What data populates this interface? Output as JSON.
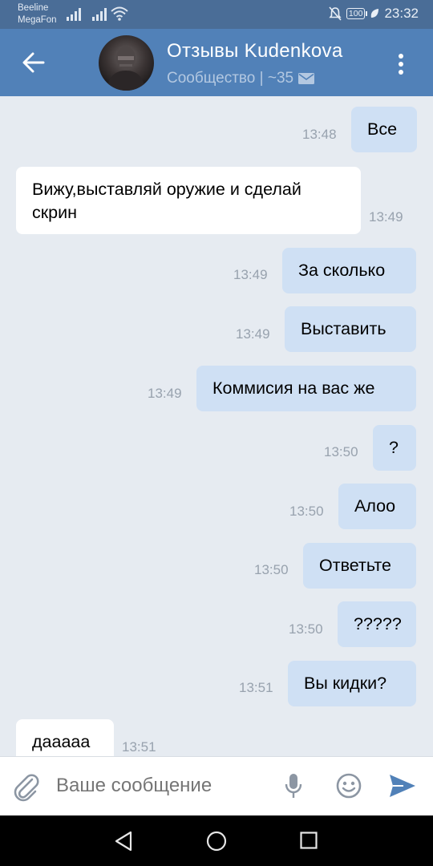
{
  "status_bar": {
    "carrier1": "Beeline",
    "carrier2": "MegaFon",
    "battery": "100",
    "time": "23:32",
    "icons": [
      "signal-icon",
      "signal-icon",
      "wifi-icon",
      "mute-icon",
      "battery-icon",
      "leaf-icon"
    ]
  },
  "header": {
    "title": "Отзывы Kudenkova",
    "subtitle": "Сообщество | ~35",
    "colors": {
      "header_bg": "#5181b8",
      "status_bg": "#4a6d97"
    }
  },
  "messages": [
    {
      "dir": "out",
      "text": "Все",
      "time": "13:48"
    },
    {
      "dir": "in",
      "text": "Вижу,выставляй оружие и сделай скрин",
      "time": "13:49"
    },
    {
      "dir": "out",
      "text": "За сколько",
      "time": "13:49"
    },
    {
      "dir": "out",
      "text": "Выставить",
      "time": "13:49"
    },
    {
      "dir": "out",
      "text": "Коммисия на вас же",
      "time": "13:49"
    },
    {
      "dir": "out",
      "text": "?",
      "time": "13:50"
    },
    {
      "dir": "out",
      "text": "Алоо",
      "time": "13:50"
    },
    {
      "dir": "out",
      "text": "Ответьте",
      "time": "13:50"
    },
    {
      "dir": "out",
      "text": "?????",
      "time": "13:50"
    },
    {
      "dir": "out",
      "text": "Вы кидки?",
      "time": "13:51"
    },
    {
      "dir": "in",
      "text": "дааааа",
      "time": "13:51"
    }
  ],
  "composer": {
    "placeholder": "Ваше сообщение"
  },
  "colors": {
    "out_bubble": "#cfe0f4",
    "in_bubble": "#ffffff",
    "chat_bg": "#e6ebf1",
    "send": "#5181b8"
  }
}
